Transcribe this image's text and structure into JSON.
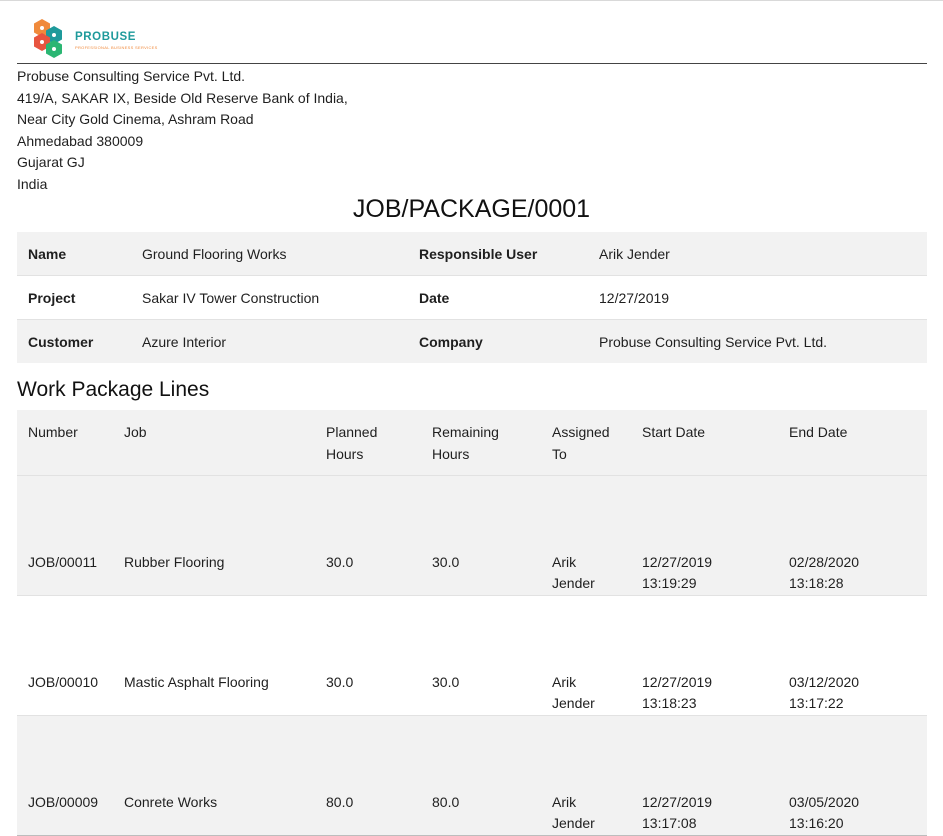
{
  "company": {
    "logo_name": "PROBUSE",
    "logo_tagline": "PROFESSIONAL BUSINESS SERVICES",
    "address_lines": [
      "Probuse Consulting Service Pvt. Ltd.",
      "419/A, SAKAR IX, Beside Old Reserve Bank of India,",
      "Near City Gold Cinema, Ashram Road",
      "Ahmedabad 380009",
      "Gujarat GJ",
      "India"
    ]
  },
  "document": {
    "title": "JOB/PACKAGE/0001"
  },
  "info": {
    "name_label": "Name",
    "name_value": "Ground Flooring Works",
    "responsible_label": "Responsible User",
    "responsible_value": "Arik Jender",
    "project_label": "Project",
    "project_value": "Sakar IV Tower Construction",
    "date_label": "Date",
    "date_value": "12/27/2019",
    "customer_label": "Customer",
    "customer_value": "Azure Interior",
    "company_label": "Company",
    "company_value": "Probuse Consulting Service Pvt. Ltd."
  },
  "lines": {
    "section_title": "Work Package Lines",
    "headers": {
      "number": "Number",
      "job": "Job",
      "planned_1": "Planned",
      "planned_2": "Hours",
      "remaining_1": "Remaining",
      "remaining_2": "Hours",
      "assigned_1": "Assigned",
      "assigned_2": "To",
      "start": "Start Date",
      "end": "End Date"
    },
    "rows": [
      {
        "number": "JOB/00011",
        "job": "Rubber Flooring",
        "planned": "30.0",
        "remaining": "30.0",
        "assigned_1": "Arik",
        "assigned_2": "Jender",
        "start_date": "12/27/2019",
        "start_time": "13:19:29",
        "end_date": "02/28/2020",
        "end_time": "13:18:28"
      },
      {
        "number": "JOB/00010",
        "job": "Mastic Asphalt Flooring",
        "planned": "30.0",
        "remaining": "30.0",
        "assigned_1": "Arik",
        "assigned_2": "Jender",
        "start_date": "12/27/2019",
        "start_time": "13:18:23",
        "end_date": "03/12/2020",
        "end_time": "13:17:22"
      },
      {
        "number": "JOB/00009",
        "job": "Conrete Works",
        "planned": "80.0",
        "remaining": "80.0",
        "assigned_1": "Arik",
        "assigned_2": "Jender",
        "start_date": "12/27/2019",
        "start_time": "13:17:08",
        "end_date": "03/05/2020",
        "end_time": "13:16:20"
      }
    ]
  }
}
